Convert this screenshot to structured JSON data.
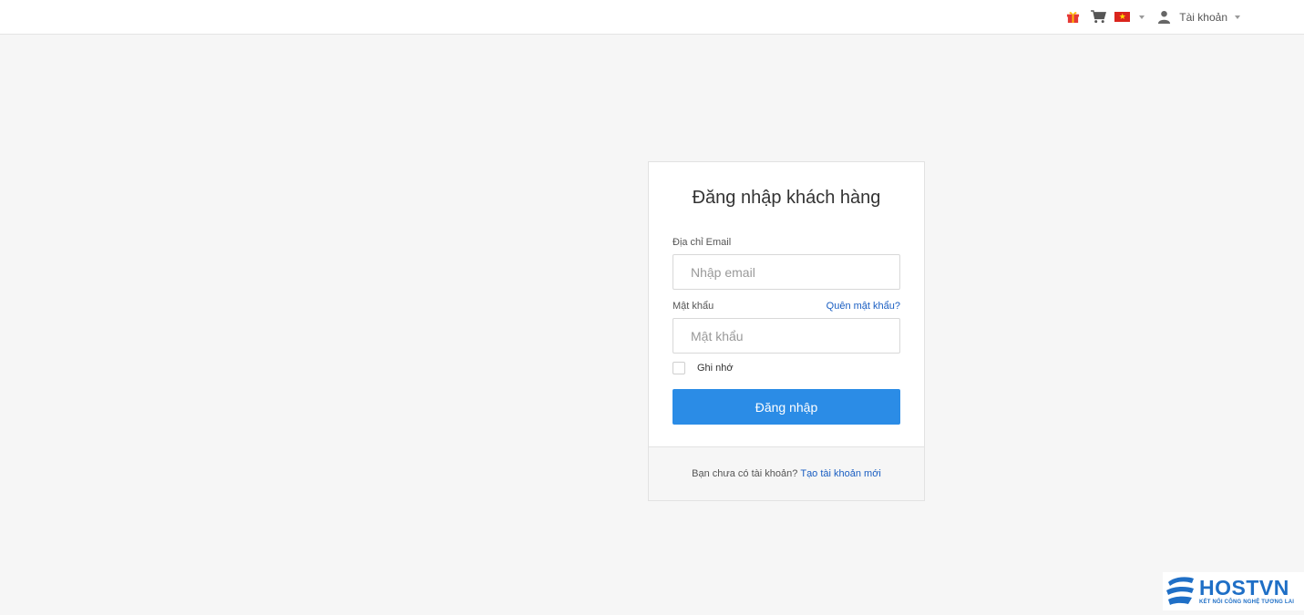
{
  "header": {
    "icons": [
      "gift-icon",
      "cart-icon",
      "vietnam-flag-icon",
      "user-icon"
    ],
    "account_label": "Tài khoản"
  },
  "login": {
    "title": "Đăng nhập khách hàng",
    "email_label": "Địa chỉ Email",
    "email_placeholder": "Nhập email",
    "email_value": "",
    "password_label": "Mật khẩu",
    "forgot_label": "Quên mật khẩu?",
    "password_placeholder": "Mật khẩu",
    "password_value": "",
    "remember_label": "Ghi nhớ",
    "remember_checked": false,
    "submit_label": "Đăng nhập",
    "no_account_text": "Bạn chưa có tài khoản?",
    "register_label": "Tạo tài khoản mới"
  },
  "brand": {
    "name": "HOSTVN",
    "tagline": "KẾT NỐI CÔNG NGHỆ TƯƠNG LAI"
  },
  "colors": {
    "primary": "#2b8ce6",
    "link": "#1a5ec2",
    "background": "#f6f6f6",
    "brand": "#1f6fc6"
  }
}
